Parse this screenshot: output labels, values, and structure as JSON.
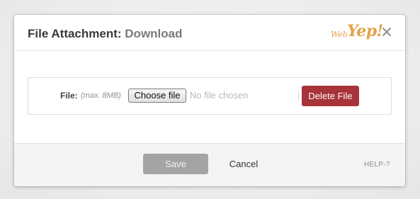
{
  "dialog": {
    "title_main": "File Attachment:",
    "title_sub": "Download",
    "logo": {
      "prefix": "Web",
      "name": "Yep!"
    },
    "close_icon": "close-icon"
  },
  "file_field": {
    "label": "File:",
    "hint": "(max. 8MB)",
    "choose_label": "Choose file",
    "status": "No file chosen",
    "delete_label": "Delete File"
  },
  "footer": {
    "save_label": "Save",
    "cancel_label": "Cancel",
    "help_label": "HELP-?"
  },
  "colors": {
    "delete_button": "#a8333a",
    "save_button_disabled": "#a4a4a4",
    "logo": "#e3a247"
  }
}
